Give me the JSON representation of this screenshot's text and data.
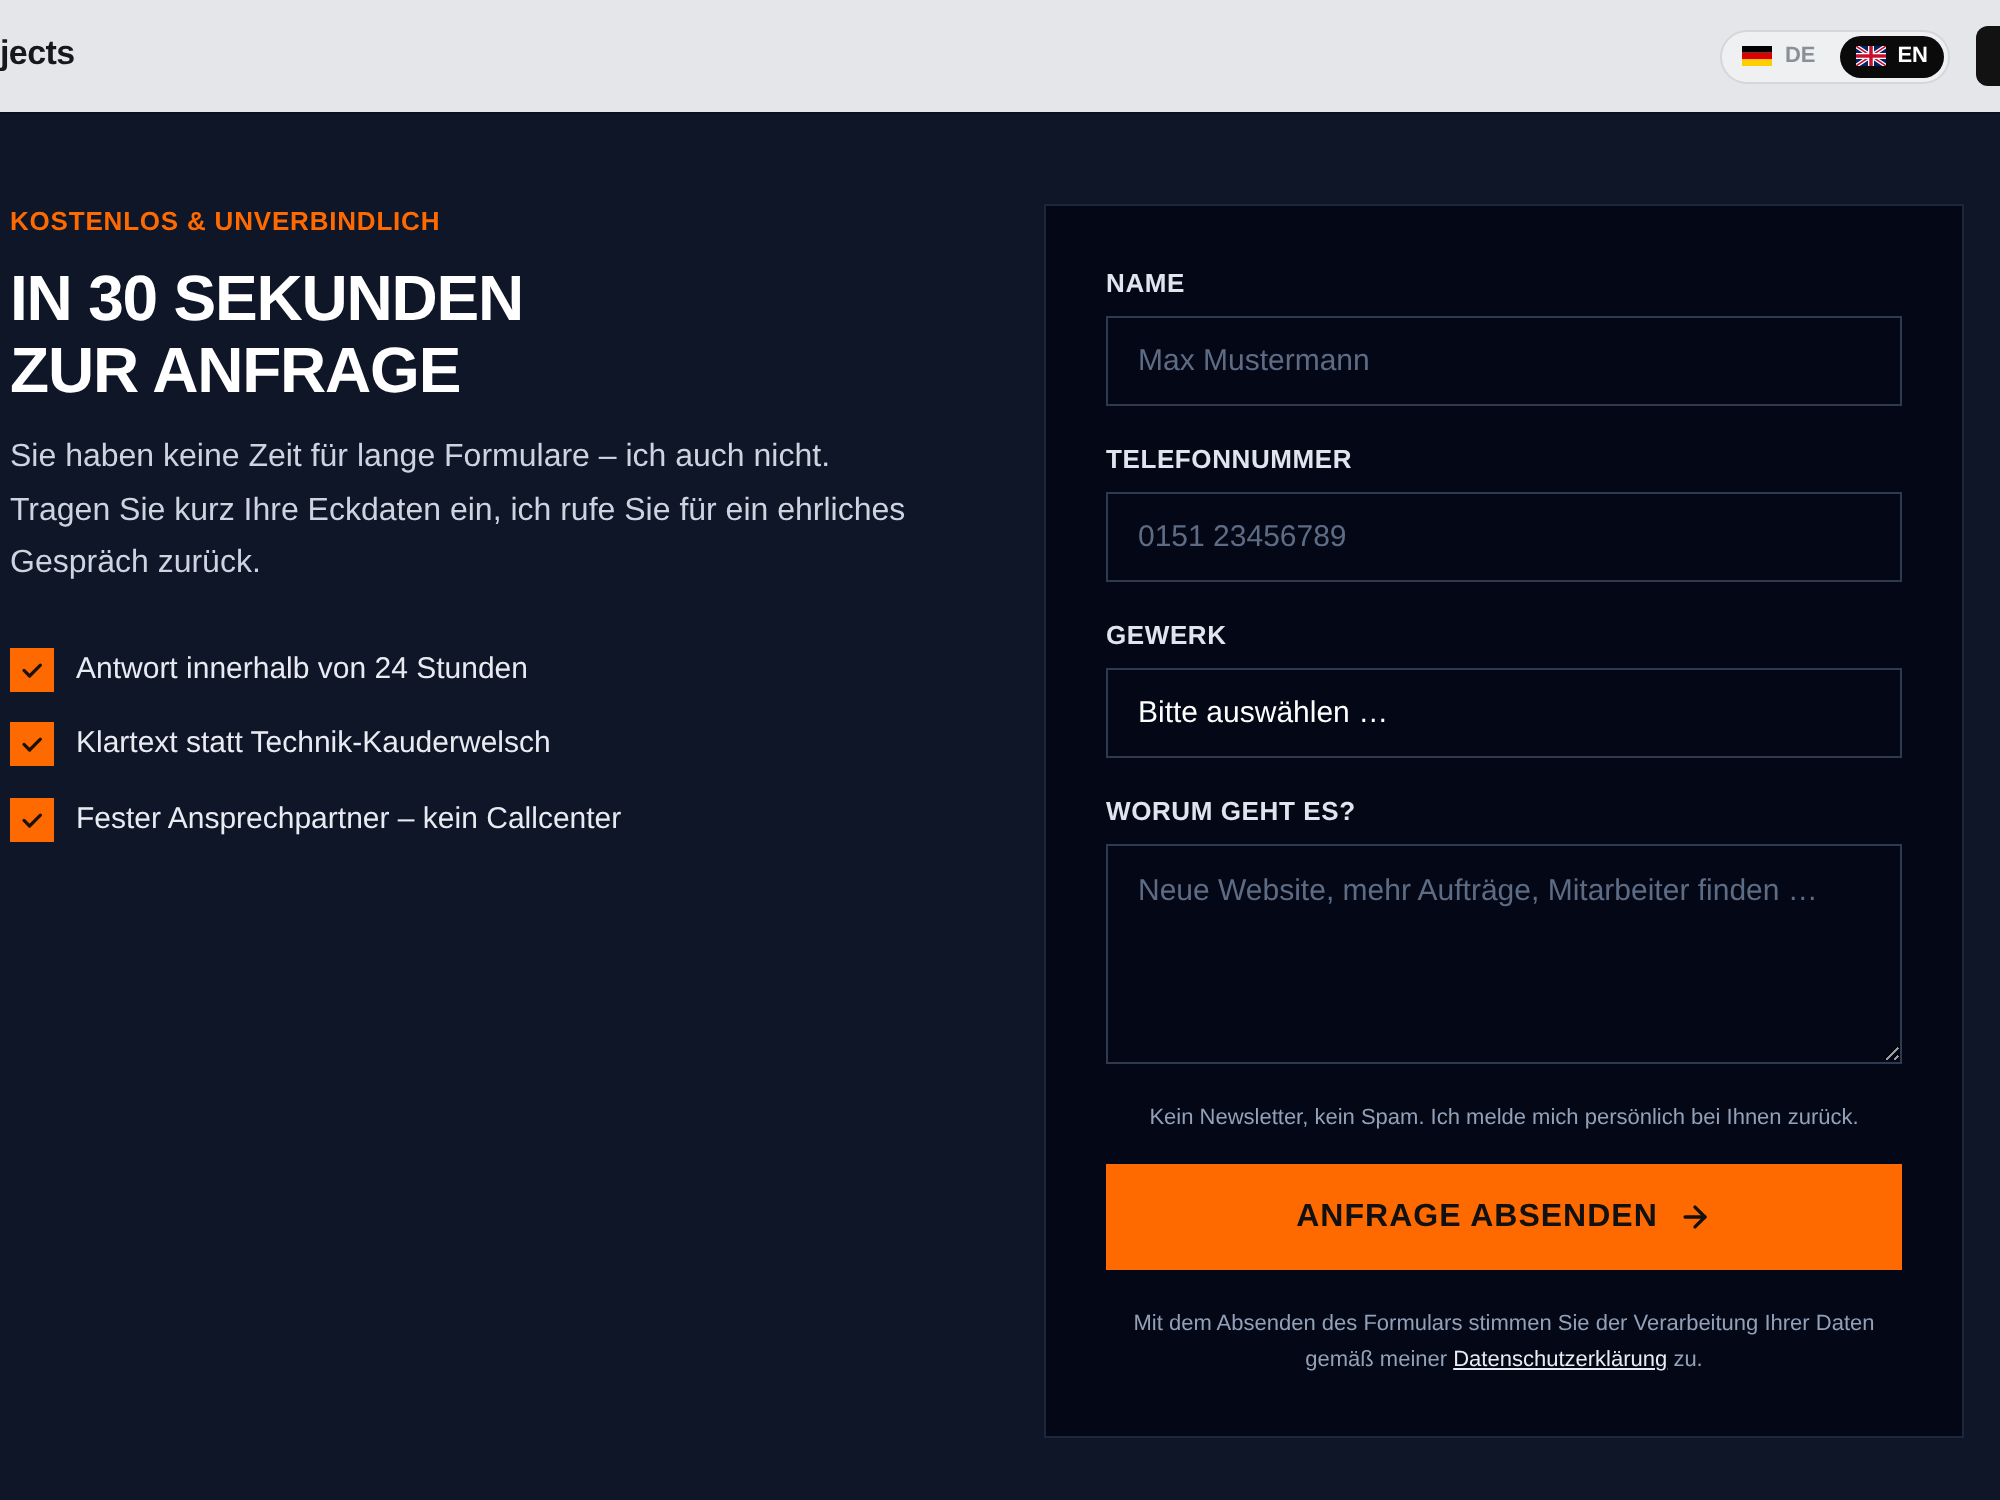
{
  "header": {
    "brand": "jects",
    "languages": [
      {
        "kind": "german",
        "code": "DE",
        "selected": false
      },
      {
        "kind": "british",
        "code": "EN",
        "selected": true
      }
    ]
  },
  "hero": {
    "eyebrow": "KOSTENLOS & UNVERBINDLICH",
    "title_lines": [
      "IN 30 SEKUNDEN",
      "ZUR ANFRAGE"
    ],
    "intro_lines": [
      "Sie haben keine Zeit für lange Formulare – ich auch nicht.",
      "Tragen Sie kurz Ihre Eckdaten ein, ich rufe Sie für ein ehrliches Gespräch zurück."
    ],
    "benefits": [
      "Antwort innerhalb von 24 Stunden",
      "Klartext statt Technik-Kauderwelsch",
      "Fester Ansprechpartner – kein Callcenter"
    ]
  },
  "form": {
    "fields": [
      {
        "kind": "input",
        "label": "NAME",
        "placeholder": "Max Mustermann"
      },
      {
        "kind": "input",
        "label": "TELEFONNUMMER",
        "placeholder": "0151 23456789"
      },
      {
        "kind": "select",
        "label": "GEWERK",
        "value": "Bitte auswählen …"
      },
      {
        "kind": "textarea",
        "label": "WORUM GEHT ES?",
        "placeholder": "Neue Website, mehr Aufträge, Mitarbeiter finden …"
      }
    ],
    "note": "Kein Newsletter, kein Spam. Ich melde mich persönlich bei Ihnen zurück.",
    "submit": "ANFRAGE ABSENDEN",
    "consent": {
      "before": "Mit dem Absenden des Formulars stimmen Sie der Verarbeitung Ihrer Daten gemäß meiner",
      "link": "Datenschutzerklärung",
      "after": "zu."
    }
  }
}
